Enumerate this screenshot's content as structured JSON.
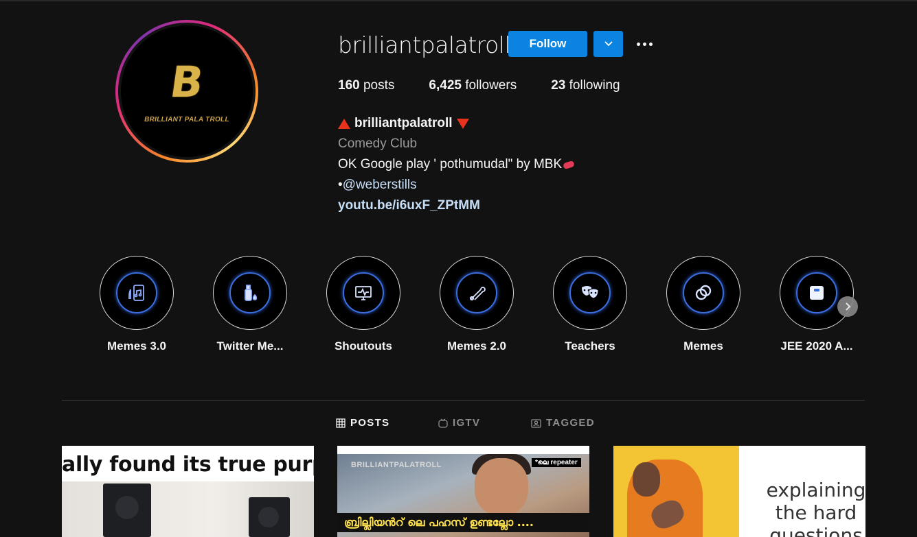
{
  "profile": {
    "username": "brilliantpalatroll",
    "follow_label": "Follow",
    "avatar_logo_letter": "B",
    "avatar_logo_text": "BRILLIANT PALA TROLL",
    "stats": {
      "posts_count": "160",
      "posts_label": "posts",
      "followers_count": "6,425",
      "followers_label": "followers",
      "following_count": "23",
      "following_label": "following"
    },
    "bio": {
      "full_name": "brilliantpalatroll",
      "category": "Comedy Club",
      "line1": "OK Google play ' pothumudal\" by MBK",
      "bullet": "•",
      "mention": "@weberstills",
      "link": "youtu.be/i6uxF_ZPtMM"
    }
  },
  "highlights": [
    {
      "label": "Memes 3.0",
      "icon": "phone-music-icon"
    },
    {
      "label": "Twitter Me...",
      "icon": "bottle-icon"
    },
    {
      "label": "Shoutouts",
      "icon": "monitor-pulse-icon"
    },
    {
      "label": "Memes 2.0",
      "icon": "safety-pin-icon"
    },
    {
      "label": "Teachers",
      "icon": "theater-masks-icon"
    },
    {
      "label": "Memes",
      "icon": "rings-icon"
    },
    {
      "label": "JEE 2020 A...",
      "icon": "scale-icon"
    }
  ],
  "tabs": [
    {
      "label": "POSTS",
      "icon": "grid-icon",
      "active": true
    },
    {
      "label": "IGTV",
      "icon": "igtv-icon",
      "active": false
    },
    {
      "label": "TAGGED",
      "icon": "tagged-icon",
      "active": false
    }
  ],
  "posts": [
    {
      "caption": "ally found its true purp"
    },
    {
      "watermark": "BRILLIANTPALATROLL",
      "tag": "*ലെ repeater",
      "subtitle": "ബ്രില്ലിയൻറ് ലെ പഹസ് ഉണ്ടല്ലോ ...."
    },
    {
      "text": "explaining the hard questions"
    }
  ],
  "colors": {
    "background": "#121212",
    "follow_button": "#0a84e0",
    "link": "#c7def7",
    "highlight_glow": "#3b6fe0",
    "triangle": "#e8321c"
  }
}
